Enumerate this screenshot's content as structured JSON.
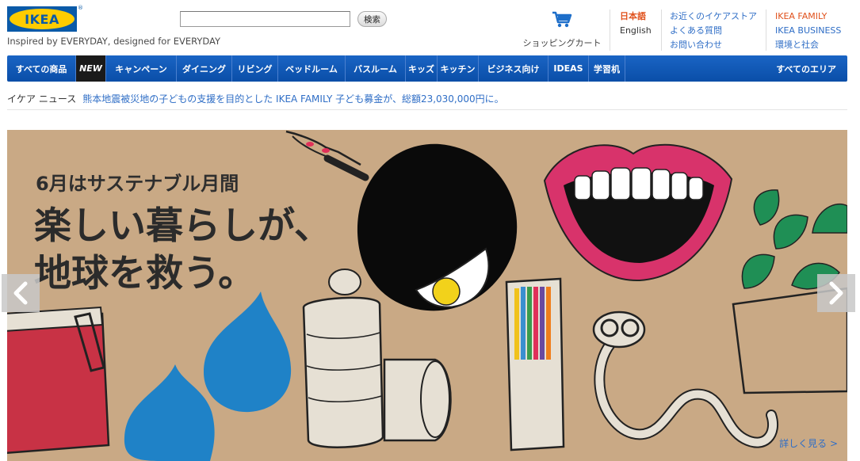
{
  "brand": {
    "logo_text": "IKEA",
    "registered_mark": "®",
    "tagline": "Inspired by EVERYDAY, designed for EVERYDAY",
    "logo_blue": "#0a5aa8",
    "logo_yellow": "#ffcc00"
  },
  "search": {
    "value": "",
    "placeholder": "",
    "button_label": "検索"
  },
  "cart": {
    "icon": "shopping-cart-icon",
    "label": "ショッピングカート"
  },
  "languages": {
    "current": "日本語",
    "alternate": "English"
  },
  "help_links": [
    "お近くのイケアストア",
    "よくある質問",
    "お問い合わせ"
  ],
  "corporate_links": [
    "IKEA FAMILY",
    "IKEA BUSINESS",
    "環境と社会"
  ],
  "nav": {
    "items": [
      "すべての商品",
      "NEW",
      "キャンペーン",
      "ダイニング",
      "リビング",
      "ベッドルーム",
      "バスルーム",
      "キッズ",
      "キッチン",
      "ビジネス向け",
      "IDEAS",
      "学習机"
    ],
    "all_areas": "すべてのエリア"
  },
  "news": {
    "heading": "イケア ニュース",
    "link_text": "熊本地震被災地の子どもの支援を目的とした IKEA FAMILY 子ども募金が、総額23,030,000円に。"
  },
  "hero": {
    "subtitle": "6月はサステナブル月間",
    "title_line1": "楽しい暮らしが、",
    "title_line2": "地球を救う。",
    "more_link": "詳しく見る >",
    "background": "#c9a985",
    "prev_icon": "chevron-left-icon",
    "next_icon": "chevron-right-icon"
  },
  "colors": {
    "nav_blue": "#0a4ea8",
    "link_blue": "#2f6ec6",
    "accent_orange": "#e0511c"
  }
}
